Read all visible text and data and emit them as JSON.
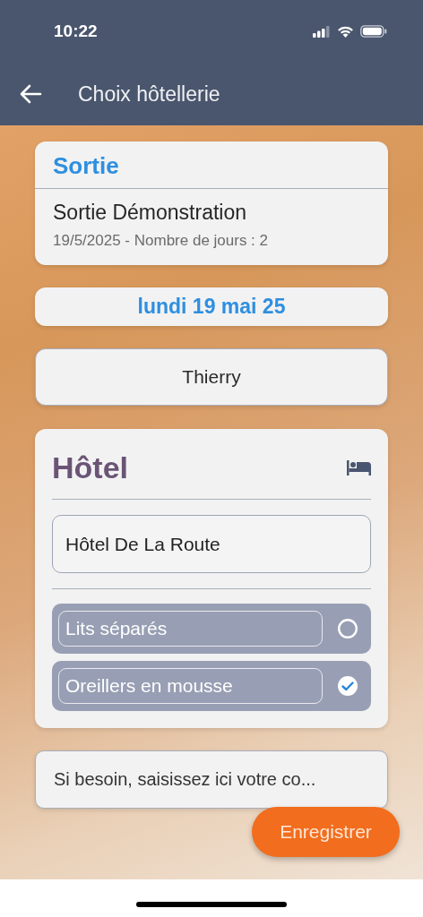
{
  "status_bar": {
    "time": "10:22"
  },
  "app_bar": {
    "title": "Choix hôtellerie"
  },
  "outing": {
    "heading": "Sortie",
    "name": "Sortie Démonstration",
    "details": "19/5/2025 - Nombre de jours : 2"
  },
  "date": "lundi 19 mai 25",
  "person": "Thierry",
  "hotel": {
    "heading": "Hôtel",
    "name": "Hôtel De La Route",
    "options": [
      {
        "label": "Lits séparés",
        "checked": false
      },
      {
        "label": "Oreillers en mousse",
        "checked": true
      }
    ]
  },
  "comment": {
    "placeholder": "Si besoin, saisissez ici votre co..."
  },
  "save_button": "Enregistrer"
}
